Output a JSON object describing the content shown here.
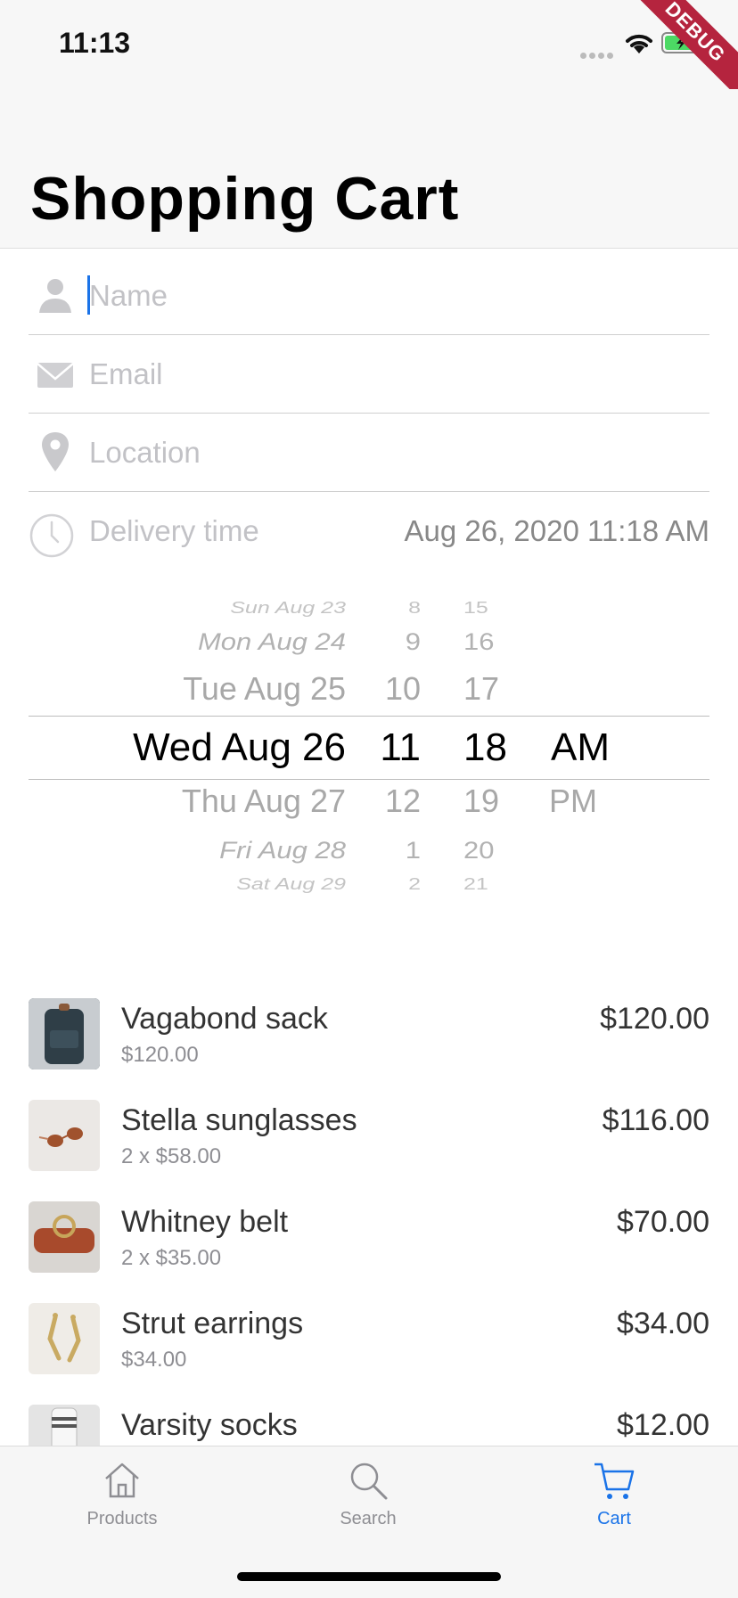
{
  "status_bar": {
    "time": "11:13",
    "debug_label": "DEBUG"
  },
  "header": {
    "title": "Shopping Cart"
  },
  "form": {
    "name_placeholder": "Name",
    "email_placeholder": "Email",
    "location_placeholder": "Location",
    "delivery_label": "Delivery time",
    "delivery_value": "Aug 26, 2020 11:18 AM"
  },
  "picker": {
    "dates": [
      "Sun Aug 23",
      "Mon Aug 24",
      "Tue Aug 25",
      "Wed Aug 26",
      "Thu Aug 27",
      "Fri Aug 28",
      "Sat Aug 29"
    ],
    "hours": [
      "8",
      "9",
      "10",
      "11",
      "12",
      "1",
      "2"
    ],
    "minutes": [
      "15",
      "16",
      "17",
      "18",
      "19",
      "20",
      "21"
    ],
    "periods": [
      "AM",
      "PM"
    ],
    "selected": {
      "date": "Wed Aug 26",
      "hour": "11",
      "minute": "18",
      "period": "AM"
    }
  },
  "cart_items": [
    {
      "name": "Vagabond sack",
      "detail": "$120.00",
      "total": "$120.00",
      "thumb_color": "#3a4a52"
    },
    {
      "name": "Stella sunglasses",
      "detail": "2 x $58.00",
      "total": "$116.00",
      "thumb_color": "#e9e6e3"
    },
    {
      "name": "Whitney belt",
      "detail": "2 x $35.00",
      "total": "$70.00",
      "thumb_color": "#a84a2c"
    },
    {
      "name": "Strut earrings",
      "detail": "$34.00",
      "total": "$34.00",
      "thumb_color": "#d8c7a0"
    },
    {
      "name": "Varsity socks",
      "detail": "",
      "total": "$12.00",
      "thumb_color": "#dcdcdc"
    }
  ],
  "tabs": [
    {
      "label": "Products",
      "icon": "home-icon",
      "active": false
    },
    {
      "label": "Search",
      "icon": "search-icon",
      "active": false
    },
    {
      "label": "Cart",
      "icon": "cart-icon",
      "active": true
    }
  ],
  "colors": {
    "accent": "#1a73e8",
    "debug_banner": "#b5243e",
    "placeholder": "#c2c2c6",
    "tab_inactive": "#8e8e93"
  }
}
